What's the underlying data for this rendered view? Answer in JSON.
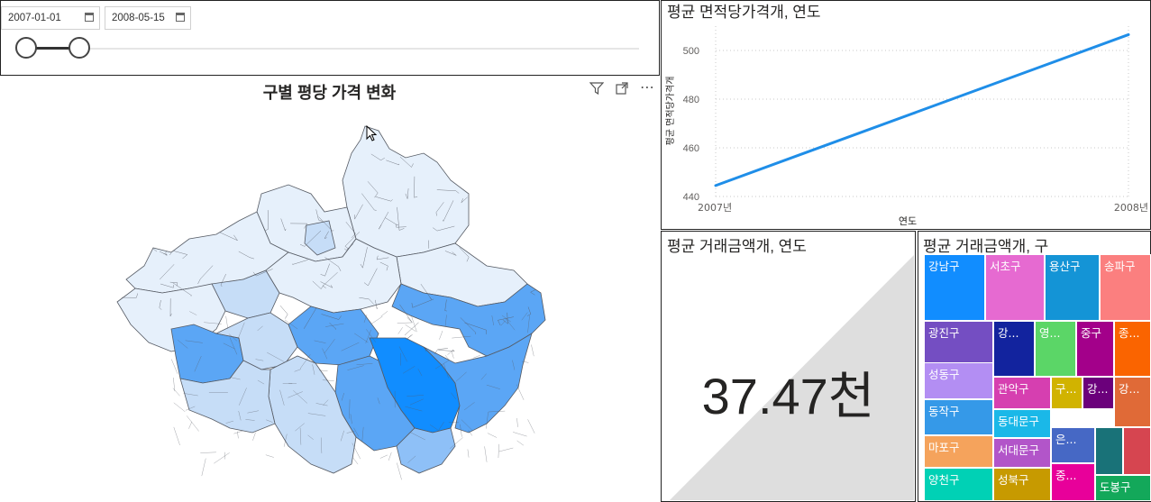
{
  "slicer": {
    "start_date": "2007-01-01",
    "end_date": "2008-05-15"
  },
  "map": {
    "title": "구별 평당 가격 변화",
    "colors": {
      "darkest": "#118dff",
      "dark": "#5ba6f5",
      "mid": "#8ec0f7",
      "light": "#c6ddf7",
      "lightest": "#e6f0fb",
      "border": "#555a63"
    }
  },
  "line_chart": {
    "title": "평균 면적당가격개, 연도",
    "color": "#1f8ee8"
  },
  "chart_data": {
    "type": "line",
    "title": "평균 면적당가격개, 연도",
    "xlabel": "연도",
    "ylabel": "평균 면적당가격개",
    "categories": [
      "2007년",
      "2008년"
    ],
    "values": [
      444.5,
      506.5
    ],
    "ylim": [
      440,
      510
    ],
    "yticks": [
      440,
      460,
      480,
      500
    ],
    "grid": true
  },
  "card": {
    "title": "평균 거래금액개, 연도",
    "value": "37.47천"
  },
  "treemap": {
    "title": "평균 거래금액개, 구",
    "tiles": [
      {
        "label": "강남구",
        "color": "#118dff"
      },
      {
        "label": "서초구",
        "color": "#e66ad1"
      },
      {
        "label": "용산구",
        "color": "#1494d6"
      },
      {
        "label": "송파구",
        "color": "#fb7f7f"
      },
      {
        "label": "광진구",
        "color": "#744ec2"
      },
      {
        "label": "강...",
        "color": "#12239e"
      },
      {
        "label": "영...",
        "color": "#5bd667"
      },
      {
        "label": "중구",
        "color": "#a3008a"
      },
      {
        "label": "종...",
        "color": "#fa6400"
      },
      {
        "label": "성동구",
        "color": "#b38ef3"
      },
      {
        "label": "관악구",
        "color": "#d63fb0"
      },
      {
        "label": "구...",
        "color": "#d1b300"
      },
      {
        "label": "강...",
        "color": "#6b007b"
      },
      {
        "label": "강...",
        "color": "#e06a37"
      },
      {
        "label": "동작구",
        "color": "#3599e8"
      },
      {
        "label": "동대문구",
        "color": "#1ab8e8"
      },
      {
        "label": "마포구",
        "color": "#f5a35c"
      },
      {
        "label": "서대문구",
        "color": "#b255c9"
      },
      {
        "label": "은...",
        "color": "#4668c5"
      },
      {
        "label": "",
        "color": "#197278"
      },
      {
        "label": "",
        "color": "#d64550"
      },
      {
        "label": "양천구",
        "color": "#00d1b5"
      },
      {
        "label": "성북구",
        "color": "#c79a00"
      },
      {
        "label": "중...",
        "color": "#e8009a"
      },
      {
        "label": "도봉구",
        "color": "#13a85a"
      }
    ]
  }
}
